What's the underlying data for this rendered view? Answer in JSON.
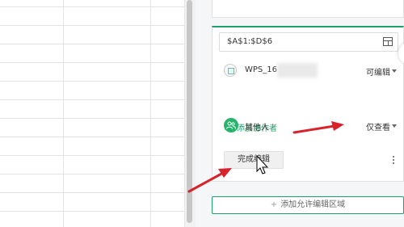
{
  "range": {
    "value": "$A$1:$D$6"
  },
  "user": {
    "name": "WPS_16",
    "permission": "可编辑"
  },
  "add_collaborator": "添加协作者",
  "others": {
    "label": "其他人",
    "permission": "仅查看"
  },
  "done_button": "完成编辑",
  "add_area_button": {
    "icon": "+",
    "label": "添加允许编辑区域"
  },
  "colors": {
    "accent": "#1f9f6a",
    "arrow": "#d9232c",
    "group_avatar": "#28b36d"
  }
}
